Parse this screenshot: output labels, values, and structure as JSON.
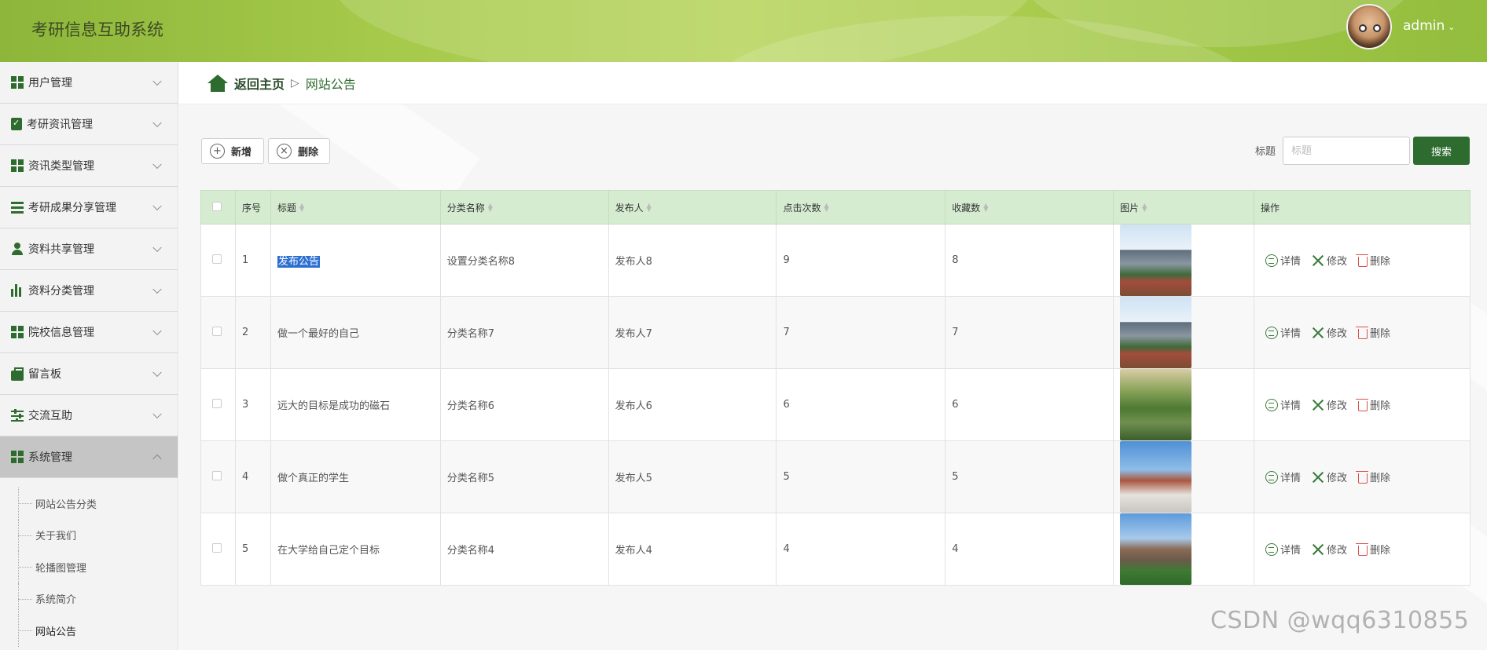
{
  "header": {
    "title": "考研信息互助系统",
    "user": "admin"
  },
  "sidebar": {
    "items": [
      {
        "label": "用户管理",
        "icon": "grid-icon"
      },
      {
        "label": "考研资讯管理",
        "icon": "clipboard-check-icon"
      },
      {
        "label": "资讯类型管理",
        "icon": "grid-icon"
      },
      {
        "label": "考研成果分享管理",
        "icon": "list-icon"
      },
      {
        "label": "资料共享管理",
        "icon": "person-icon"
      },
      {
        "label": "资料分类管理",
        "icon": "bar-chart-icon"
      },
      {
        "label": "院校信息管理",
        "icon": "grid-icon"
      },
      {
        "label": "留言板",
        "icon": "briefcase-icon"
      },
      {
        "label": "交流互助",
        "icon": "sliders-icon"
      },
      {
        "label": "系统管理",
        "icon": "grid-icon"
      }
    ],
    "submenu": [
      "网站公告分类",
      "关于我们",
      "轮播图管理",
      "系统简介",
      "网站公告"
    ]
  },
  "breadcrumb": {
    "home": "返回主页",
    "current": "网站公告"
  },
  "toolbar": {
    "add": "新增",
    "delete": "删除"
  },
  "search": {
    "label": "标题",
    "placeholder": "标题",
    "button": "搜索"
  },
  "table": {
    "headers": [
      "序号",
      "标题",
      "分类名称",
      "发布人",
      "点击次数",
      "收藏数",
      "图片",
      "操作"
    ],
    "actions": [
      "详情",
      "修改",
      "删除"
    ],
    "rows": [
      {
        "no": "1",
        "title": "发布公告",
        "category": "设置分类名称8",
        "publisher": "发布人8",
        "clicks": "9",
        "favorites": "8"
      },
      {
        "no": "2",
        "title": "做一个最好的自己",
        "category": "分类名称7",
        "publisher": "发布人7",
        "clicks": "7",
        "favorites": "7"
      },
      {
        "no": "3",
        "title": "远大的目标是成功的磁石",
        "category": "分类名称6",
        "publisher": "发布人6",
        "clicks": "6",
        "favorites": "6"
      },
      {
        "no": "4",
        "title": "做个真正的学生",
        "category": "分类名称5",
        "publisher": "发布人5",
        "clicks": "5",
        "favorites": "5"
      },
      {
        "no": "5",
        "title": "在大学给自己定个目标",
        "category": "分类名称4",
        "publisher": "发布人4",
        "clicks": "4",
        "favorites": "4"
      }
    ]
  },
  "watermark": "CSDN @wqq6310855",
  "colors": {
    "accent": "#2e6b2e",
    "header_bg": "#a5c94a",
    "table_head": "#d5ecd0",
    "delete": "#d9534f"
  }
}
